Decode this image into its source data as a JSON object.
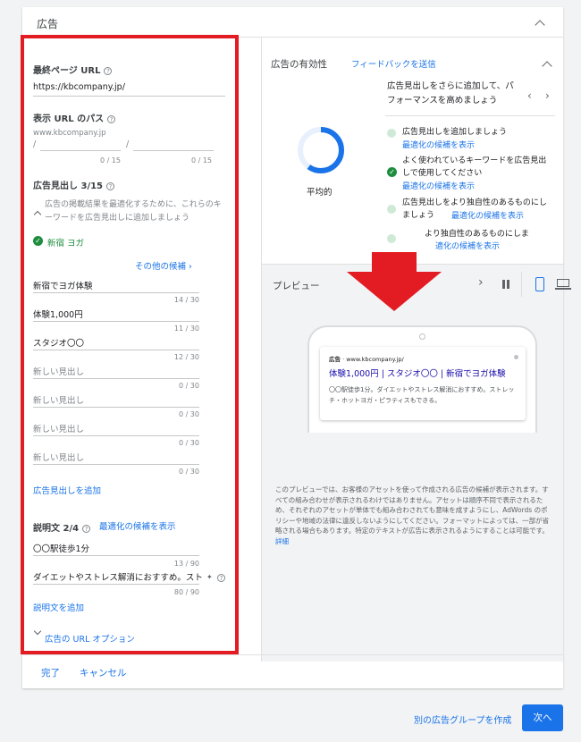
{
  "section": {
    "title": "広告"
  },
  "left": {
    "final_url_label": "最終ページ URL",
    "final_url_value": "https://kbcompany.jp/",
    "path_label": "表示 URL のパス",
    "path_domain": "www.kbcompany.jp",
    "path_slash1": "/",
    "path_slash2": "/",
    "path_counter1": "0 / 15",
    "path_counter2": "0 / 15",
    "headlines_label": "広告見出し 3/15",
    "headline_hint": "広告の掲載結果を最適化するために、これらのキーワードを広告見出しに追加しましょう",
    "keyword_chip": "新宿 ヨガ",
    "more_candidates": "その他の候補",
    "headlines": [
      {
        "value": "新宿でヨガ体験",
        "placeholder": "",
        "counter": "14 / 30"
      },
      {
        "value": "体験1,000円",
        "placeholder": "",
        "counter": "11 / 30"
      },
      {
        "value": "スタジオ〇〇",
        "placeholder": "",
        "counter": "12 / 30"
      },
      {
        "value": "",
        "placeholder": "新しい見出し",
        "counter": "0 / 30"
      },
      {
        "value": "",
        "placeholder": "新しい見出し",
        "counter": "0 / 30"
      },
      {
        "value": "",
        "placeholder": "新しい見出し",
        "counter": "0 / 30"
      },
      {
        "value": "",
        "placeholder": "新しい見出し",
        "counter": "0 / 30"
      }
    ],
    "add_headline": "広告見出しを追加",
    "desc_label": "説明文 2/4",
    "desc_suggest": "最適化の候補を表示",
    "descriptions": [
      {
        "value": "〇〇駅徒歩1分",
        "counter": "13 / 90"
      },
      {
        "value": "ダイエットやストレス解消におすすめ。スト",
        "counter": "80 / 90"
      }
    ],
    "add_desc": "説明文を追加",
    "url_options": "広告の URL オプション"
  },
  "effectiveness": {
    "title": "広告の有効性",
    "feedback": "フィードバックを送信",
    "rating": "平均的",
    "ring_fraction": 0.6,
    "tip_header": "広告見出しをさらに追加して、パフォーマンスを高めましょう",
    "items": [
      {
        "text": "広告見出しを追加しましょう",
        "link": "最適化の候補を表示",
        "done": false
      },
      {
        "text": "よく使われているキーワードを広告見出しで使用してください",
        "link": "最適化の候補を表示",
        "done": true
      },
      {
        "text": "広告見出しをより独自性のあるものにしましょう",
        "link": "最適化の候補を表示",
        "done": false
      },
      {
        "text": "より独自性のあるものにしま",
        "link": "適化の候補を表示",
        "done": false
      }
    ]
  },
  "preview": {
    "title": "プレビュー",
    "ad_label": "広告",
    "ad_url": "www.kbcompany.jp/",
    "ad_headline": "体験1,000円 | スタジオ〇〇 | 新宿でヨガ体験",
    "ad_desc": "〇〇駅徒歩1分。ダイエットやストレス解消におすすめ。ストレッチ・ホットヨガ・ピラティスもできる。",
    "disclaimer": "このプレビューでは、お客様のアセットを使って作成される広告の候補が表示されます。すべての組み合わせが表示されるわけではありません。アセットは順序不同で表示されるため、それぞれのアセットが単体でも組み合わされても意味を成すようにし、AdWords のポリシーや地域の法律に違反しないようにしてください。フォーマットによっては、一部が省略される場合もあります。特定のテキストが広告に表示されるようにすることは可能です。",
    "detail_link": "詳細"
  },
  "footer": {
    "done": "完了",
    "cancel": "キャンセル"
  },
  "bottom": {
    "other_group": "別の広告グループを作成",
    "next": "次へ"
  },
  "colors": {
    "accent": "#1a73e8",
    "highlight": "#e31b23",
    "success": "#1e8e3e"
  }
}
